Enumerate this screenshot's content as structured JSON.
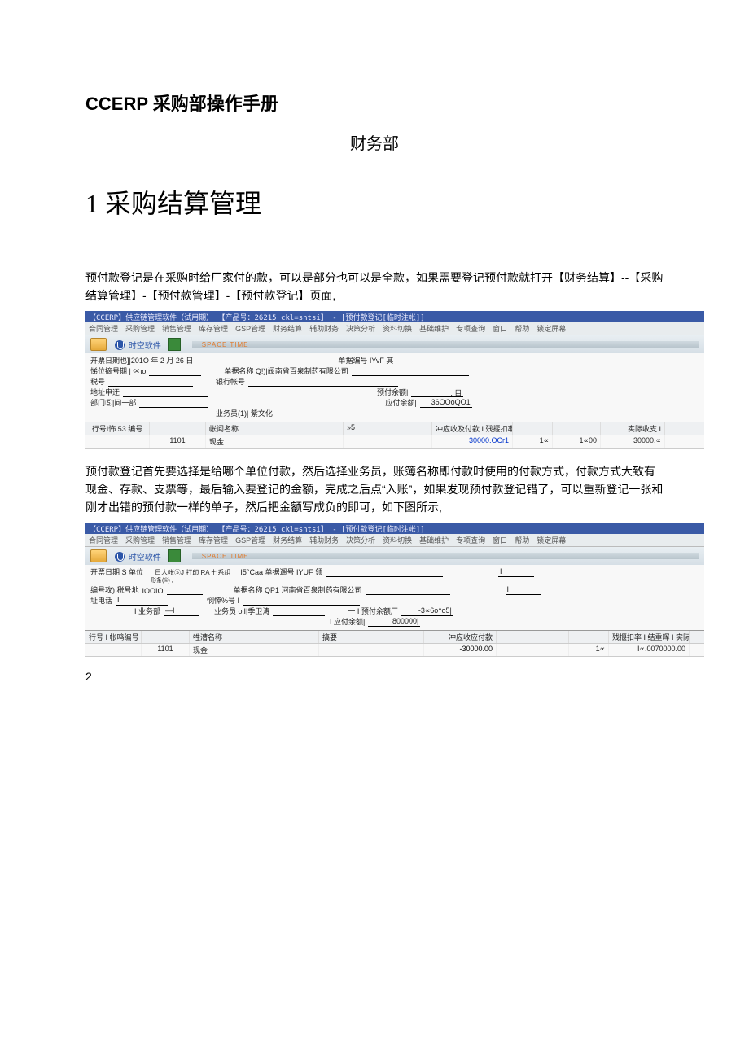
{
  "title": "CCERP 采购部操作手册",
  "subtitle": "财务部",
  "section_number": "1",
  "section_title": "采购结算管理",
  "para1": "预付款登记是在采购时给厂家付的款，可以是部分也可以是全款，如果需要登记预付款就打开【财务结算】--【采购结算管理】-【预付款管理】-【预付款登记】页面,",
  "para2": "预付款登记首先要选择是给哪个单位付款，然后选择业务员，账簿名称即付款时使用的付款方式，付款方式大致有现金、存款、支票等，最后输入要登记的金额，完成之后点“入账”，如果发现预付款登记错了，可以重新登记一张和刚才出错的预付款一样的单子，然后把金额写成负的即可，如下图所示,",
  "page_number": "2",
  "app1": {
    "titlebar": "【CCERP】供应链管理软件（试用期） 【产品号：26215  ckl=sntsi】 - [预付款登记[临时注帐]]",
    "menus": [
      "合同管理",
      "采购管理",
      "销售管理",
      "库存管理",
      "GSP管理",
      "财务结算",
      "辅助财务",
      "决策分析",
      "资料切换",
      "基础维护",
      "专项查询",
      "窗口",
      "帮助",
      "锁定屏幕"
    ],
    "toolbar_brand": "时空软件",
    "toolbar_track": "SPACE TIME",
    "form": {
      "invoice_date_label": "开票日期也]|201O 年 2 月 26 日",
      "doc_no_label": "单据编号 IYvF 其",
      "unit_code_label": "悌位摘号期 | ∝ιo",
      "unit_name_label": "单据名称 Q!)|阀南省百泉制药有限公司",
      "tax_label": "税号",
      "bank_label": "银行帐号",
      "addr_label": "地址申迂",
      "prepay_balance_label": "预付余额|",
      "prepay_balance_value": ", 目",
      "dept_label": "部门⑤|问一部",
      "payable_label": "应付余额|",
      "payable_value": "36OOoQO1",
      "operator_label": "业务员(1)| 紫文化"
    },
    "grid": {
      "headers": [
        "行号I怖 53 编号",
        "帐闻名称",
        "»5",
        "冲应收及付款 I 残揠扣率 I",
        "",
        "",
        "实际收支 I"
      ],
      "row": {
        "code": "1101",
        "name": "现金",
        "amount": "30000.OCr1",
        "col_a": "1∝",
        "col_b": "1∝00",
        "actual": "30000.∝"
      }
    }
  },
  "app2": {
    "titlebar": "【CCERP】供应链管理软件（试用期） 【产品号：26215  ckl=sntsi】 - [预付款登记[临时注帐]]",
    "menus": [
      "合同管理",
      "采购管理",
      "销售管理",
      "库存管理",
      "GSP管理",
      "财务结算",
      "辅助财务",
      "决策分析",
      "资料切换",
      "基础维护",
      "专项查询",
      "窗口",
      "帮助",
      "锁定屏幕"
    ],
    "toolbar_brand": "时空软件",
    "toolbar_track": "SPACE TIME",
    "form": {
      "line1_left": "开票日期 S 单位",
      "line1_mid": "日人帐⑤J 打印 RA 七系组",
      "line1_right": "I5°Caa 单据遛号 IYUF 领",
      "line2_left_a": "形条(©) ,",
      "line2_left": "编号攻) 税号地",
      "line2_code": "IOOIO",
      "line2_name": "单据名称 QP1 河南省百泉制药有限公司",
      "line3_left": "址电话",
      "line3_acc": "悯悻%号 I",
      "line4_left": "I 业务部",
      "line4_sep": "—I",
      "line4_op": "业务员 oιI|季卫涛",
      "line4_pre_label": "一 I 预付余额厂",
      "line4_pre_value": "-3∝6o^o5|",
      "line4_pay_label": "I 应付余额|",
      "line4_pay_value": "800000|"
    },
    "grid": {
      "headers": [
        "行号 I 帐鸣编号",
        "牲漕名称",
        "搞要",
        "冲应收应付款",
        "残揠扣率 I 结重晖 I 实际收支 I"
      ],
      "row": {
        "code": "1101",
        "name": "现金",
        "amount": "-30000.00",
        "rate": "1∝",
        "actual": "I∝.0070000.00"
      }
    }
  }
}
